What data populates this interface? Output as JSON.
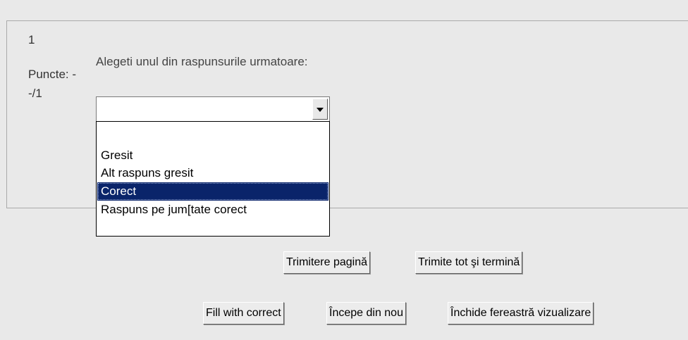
{
  "question": {
    "number": "1",
    "points_label": "Puncte: -",
    "points_value": "-/1",
    "prompt": "Alegeti unul din raspunsurile urmatoare:"
  },
  "answer_select": {
    "selected_value": "",
    "options": [
      "",
      "Gresit",
      "Alt raspuns gresit",
      "Corect",
      "Raspuns pe jum[tate corect"
    ],
    "highlighted_option": "Corect"
  },
  "page_buttons": {
    "submit_page": "Trimitere pagină",
    "submit_all": "Trimite tot şi termină"
  },
  "preview_buttons": {
    "fill_correct": "Fill with correct",
    "start_again": "Începe din nou",
    "close_preview": "Închide fereastră vizualizare"
  },
  "icons": {
    "select_arrow": "chevron-down-icon"
  }
}
